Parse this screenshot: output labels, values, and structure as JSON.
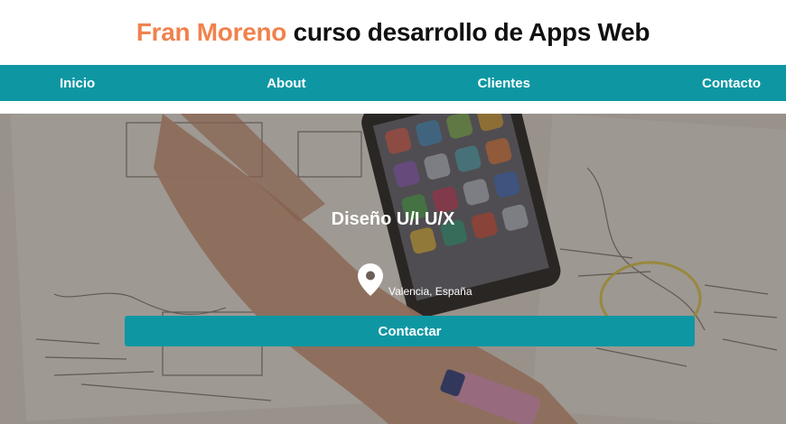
{
  "header": {
    "title_name": "Fran Moreno",
    "title_rest": " curso desarrollo de Apps Web"
  },
  "nav": {
    "items": [
      {
        "label": "Inicio"
      },
      {
        "label": "About"
      },
      {
        "label": "Clientes"
      },
      {
        "label": "Contacto"
      }
    ]
  },
  "hero": {
    "title": "Diseño U/I U/X",
    "location": "Valencia, España",
    "location_icon": "map-pin-icon",
    "cta_label": "Contactar"
  },
  "colors": {
    "accent": "#0e97a3",
    "name": "#f0824e",
    "text": "#111111"
  }
}
